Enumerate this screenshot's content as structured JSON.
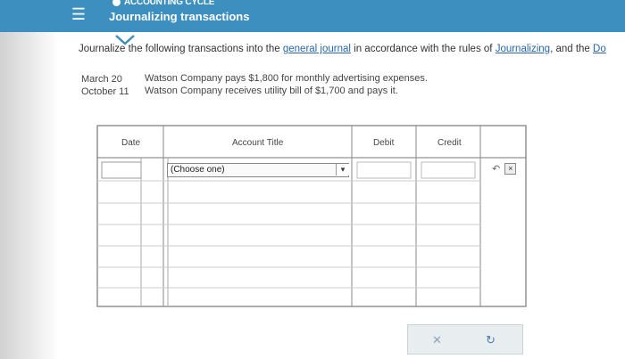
{
  "header": {
    "badge_text": "ACCOUNTING CYCLE",
    "title": "Journalizing transactions",
    "menu_icon": "hamburger-icon"
  },
  "instructions": {
    "part1": "Journalize the following transactions into the ",
    "link1": "general journal",
    "part2": " in accordance with the rules of ",
    "link2": "Journalizing",
    "part3": ", and the ",
    "link3": "Do"
  },
  "transactions": [
    {
      "date": "March   20",
      "text": "Watson Company pays $1,800 for monthly advertising expenses."
    },
    {
      "date": "October 11",
      "text": "Watson Company receives utility bill of $1,700 and pays it."
    }
  ],
  "journal": {
    "columns": [
      "Date",
      "Account Title",
      "Debit",
      "Credit"
    ],
    "select_value": "(Choose one)"
  },
  "colors": {
    "header_bg": "#3d8fc0",
    "link": "#2a66a8"
  }
}
